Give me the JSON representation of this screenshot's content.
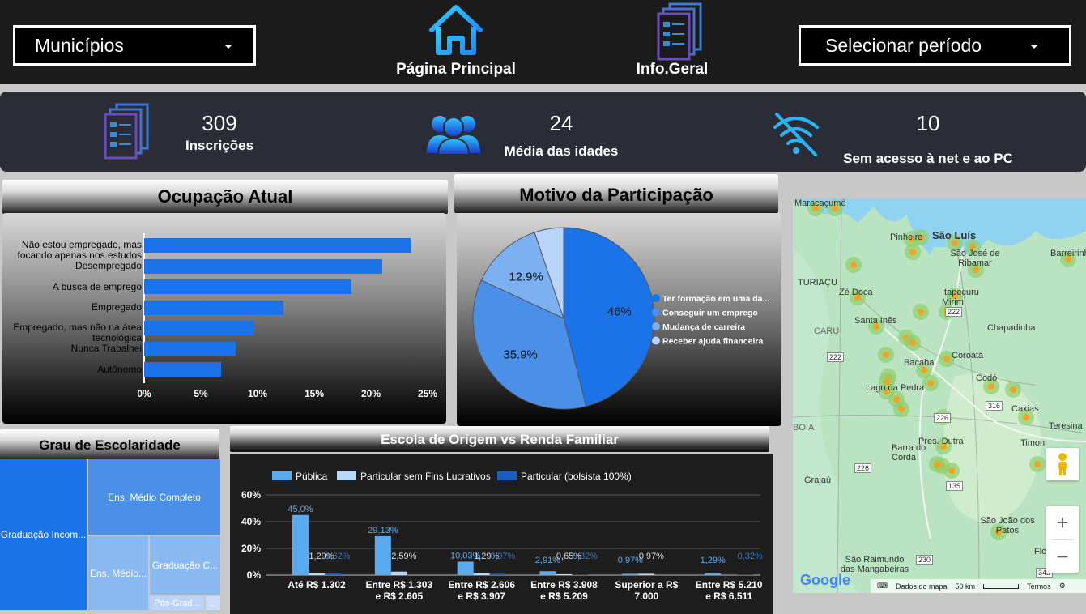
{
  "header": {
    "municipios_label": "Municípios",
    "home_label": "Página Principal",
    "info_label": "Info.Geral",
    "periodo_label": "Selecionar período"
  },
  "kpis": [
    {
      "value": "309",
      "label": "Inscrições",
      "icon": "document-icon"
    },
    {
      "value": "24",
      "label": "Média das idades",
      "icon": "people-icon"
    },
    {
      "value": "10",
      "label": "Sem acesso à net e ao PC",
      "icon": "no-wifi-icon"
    }
  ],
  "ocupacao": {
    "title": "Ocupação Atual",
    "chart_data": {
      "type": "bar",
      "orientation": "horizontal",
      "categories": [
        "Não estou empregado, mas focando apenas nos estudos",
        "Desempregado",
        "A busca de emprego",
        "Empregado",
        "Empregado, mas não na área tecnológica",
        "Nunca Trabalhei",
        "Autônomo"
      ],
      "values": [
        23.5,
        21,
        18.3,
        12.3,
        9.7,
        8.1,
        6.8
      ],
      "xticks": [
        "0%",
        "5%",
        "10%",
        "15%",
        "20%",
        "25%"
      ],
      "xlim": [
        0,
        25
      ],
      "color": "#1a73e8"
    }
  },
  "motivo": {
    "title": "Motivo da Participação",
    "chart_data": {
      "type": "pie",
      "labels": [
        "Ter formação em uma da...",
        "Conseguir um emprego",
        "Mudança de carreira",
        "Receber ajuda financeira"
      ],
      "values": [
        46,
        35.9,
        12.9,
        5.2
      ],
      "data_labels": [
        "46%",
        "35.9%",
        "12.9%",
        ""
      ],
      "colors": [
        "#1a73e8",
        "#4a8fe8",
        "#7cb0f0",
        "#b9d4f8"
      ],
      "legend": "right"
    }
  },
  "escolaridade": {
    "title": "Grau de Escolaridade",
    "cells": [
      "Graduação Incom...",
      "Ens. Médio Completo",
      "Ens. Médio...",
      "Graduação C...",
      "Pós-Grad...",
      "..."
    ]
  },
  "escola_renda": {
    "title": "Escola de Origem vs Renda Familiar",
    "chart_data": {
      "type": "bar",
      "categories": [
        "Até R$ 1.302",
        "Entre R$ 1.303 e R$ 2.605",
        "Entre R$ 2.606 e R$ 3.907",
        "Entre R$ 3.908 e R$ 5.209",
        "Superior a R$ 7.000",
        "Entre R$ 5.210 e R$ 6.511"
      ],
      "category_lines": [
        [
          "Até R$ 1.302",
          ""
        ],
        [
          "Entre R$ 1.303",
          "e R$ 2.605"
        ],
        [
          "Entre R$ 2.606",
          "e R$ 3.907"
        ],
        [
          "Entre R$ 3.908",
          "e R$ 5.209"
        ],
        [
          "Superior a R$",
          "7.000"
        ],
        [
          "Entre R$ 5.210",
          "e R$ 6.511"
        ]
      ],
      "series": [
        {
          "name": "Pública",
          "values": [
            45.0,
            29.13,
            10.03,
            2.91,
            0.97,
            1.29
          ],
          "labels": [
            "45,0%",
            "29,13%",
            "10,03%",
            "2,91%",
            "0,97%",
            "1,29%"
          ],
          "color": "#5aaaf0"
        },
        {
          "name": "Particular sem Fins Lucrativos",
          "values": [
            1.29,
            2.59,
            1.29,
            0.65,
            0.97,
            0
          ],
          "labels": [
            "1,29%",
            "2,59%",
            "1,29%",
            "0,65%",
            "0,97%",
            ""
          ],
          "color": "#b8d8f8"
        },
        {
          "name": "Particular (bolsista 100%)",
          "values": [
            1.62,
            0,
            0.97,
            0.32,
            0,
            0.32
          ],
          "labels": [
            "1,62%",
            "",
            "0,97%",
            "0,32%",
            "",
            "0,32%"
          ],
          "color": "#1a5fc0"
        }
      ],
      "yticks": [
        "0%",
        "20%",
        "40%",
        "60%"
      ],
      "ylim": [
        0,
        60
      ],
      "legend": "top"
    }
  },
  "map": {
    "labels": [
      "Maracaçumé",
      "Pinheiro",
      "São Luís",
      "São José de Ribamar",
      "Barreirinhas",
      "TURIAÇU",
      "Zé Doca",
      "Itapecuru Mirim",
      "CARU",
      "Santa Inês",
      "Chapadinha",
      "Bacabal",
      "Coroatá",
      "Lago da Pedra",
      "Codó",
      "Caxias",
      "Timon",
      "Teresina",
      "BOIA",
      "Pres. Dutra",
      "Barra do Corda",
      "Grajaú",
      "São João dos Patos",
      "São Raimundo das Mangabeiras",
      "Flo"
    ],
    "road_numbers": [
      "222",
      "222",
      "316",
      "226",
      "226",
      "135",
      "230",
      "343"
    ],
    "attribution": [
      "Dados do mapa",
      "50 km",
      "Termos"
    ],
    "logo": "Google",
    "zoom_in": "+",
    "zoom_out": "−"
  }
}
